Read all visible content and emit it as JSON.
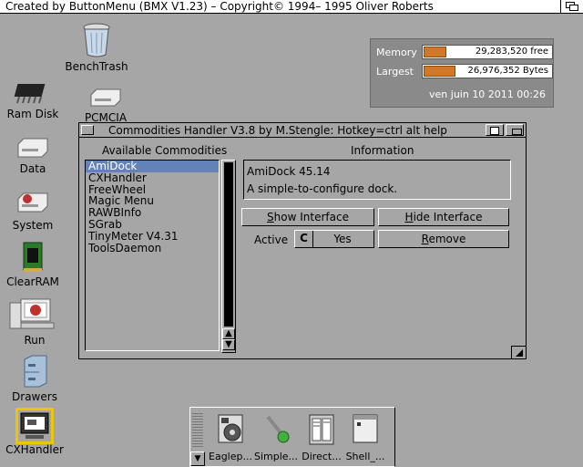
{
  "screen": {
    "title": "Created by ButtonMenu (BMX V1.23) – Copyright© 1994– 1995 Oliver Roberts"
  },
  "desktop_icons": {
    "benchtrash": "BenchTrash",
    "ramdisk": "Ram Disk",
    "pcmcia": "PCMCIA",
    "data": "Data",
    "system": "System",
    "clearram": "ClearRAM",
    "run": "Run",
    "drawers": "Drawers",
    "cxhandler": "CXHandler"
  },
  "memory": {
    "memory_label": "Memory",
    "memory_value": "29,283,520 free",
    "memory_fill_fraction": 0.18,
    "largest_label": "Largest",
    "largest_value": "26,976,352 Bytes",
    "largest_fill_fraction": 0.25,
    "datetime": "ven juin 10 2011 00:26",
    "fill_color": "#d07828"
  },
  "window": {
    "title": "Commodities Handler V3.8 by M.Stengle: Hotkey=ctrl alt help",
    "list_heading": "Available Commodities",
    "info_heading": "Information",
    "commodities": [
      "AmiDock",
      "CXHandler",
      "FreeWheel",
      "Magic Menu",
      "RAWBInfo",
      "SGrab",
      "TinyMeter V4.31",
      "ToolsDaemon"
    ],
    "selected_index": 0,
    "info_name": "AmiDock 45.14",
    "info_desc": "A simple-to-configure dock.",
    "show_interface_prefix": "S",
    "show_interface_rest": "how Interface",
    "hide_interface_prefix": "H",
    "hide_interface_rest": "ide Interface",
    "active_label": "Active",
    "active_value": "Yes",
    "remove_prefix": "R",
    "remove_rest": "emove",
    "selection_color": "#6383b8"
  },
  "dock": {
    "items": [
      "Eaglep...",
      "Simple...",
      "Direct...",
      "Shell_..."
    ]
  }
}
